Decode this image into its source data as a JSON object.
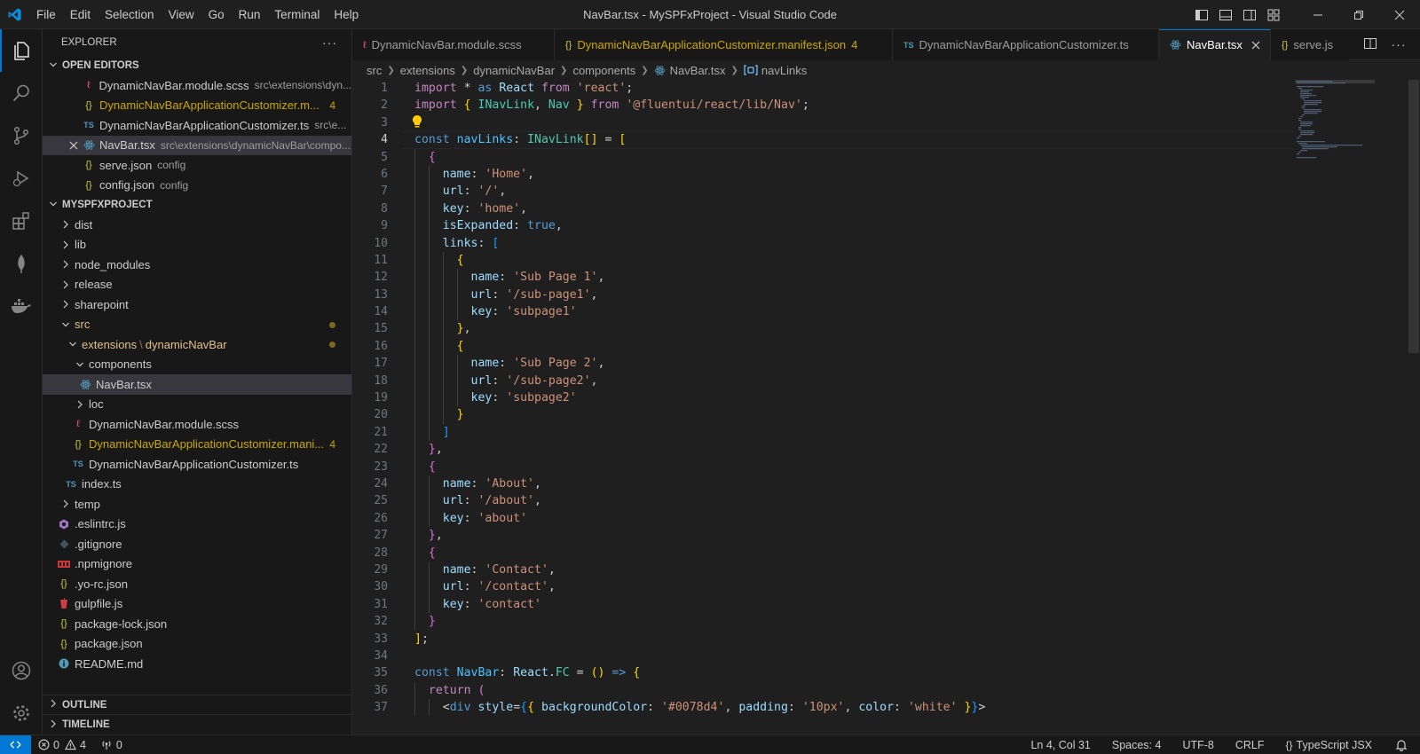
{
  "titlebar": {
    "menu": [
      "File",
      "Edit",
      "Selection",
      "View",
      "Go",
      "Run",
      "Terminal",
      "Help"
    ],
    "window_title": "NavBar.tsx - MySPFxProject - Visual Studio Code"
  },
  "colors": {
    "accent": "#0078d4",
    "warning": "#cca700",
    "modified_folder": "#e2c08d"
  },
  "explorer": {
    "header": "EXPLORER",
    "open_editors_label": "OPEN EDITORS",
    "open_editors": [
      {
        "icon": "scss-icon",
        "name": "DynamicNavBar.module.scss",
        "desc": "src\\extensions\\dyn..."
      },
      {
        "icon": "json-icon",
        "name": "DynamicNavBarApplicationCustomizer.m...",
        "badge": "4"
      },
      {
        "icon": "ts-icon",
        "name": "DynamicNavBarApplicationCustomizer.ts",
        "desc": "src\\e..."
      },
      {
        "icon": "react-icon",
        "name": "NavBar.tsx",
        "desc": "src\\extensions\\dynamicNavBar\\compo..."
      },
      {
        "icon": "json-icon",
        "name": "serve.json",
        "desc": "config"
      },
      {
        "icon": "json-icon",
        "name": "config.json",
        "desc": "config"
      }
    ],
    "project_label": "MYSPFXPROJECT",
    "tree": [
      {
        "name": "dist"
      },
      {
        "name": "lib"
      },
      {
        "name": "node_modules"
      },
      {
        "name": "release"
      },
      {
        "name": "sharepoint"
      },
      {
        "name": "src"
      },
      {
        "name": "extensions",
        "sep": "\\",
        "name2": "dynamicNavBar"
      },
      {
        "name": "components"
      },
      {
        "name": "NavBar.tsx"
      },
      {
        "name": "loc"
      },
      {
        "name": "DynamicNavBar.module.scss"
      },
      {
        "name": "DynamicNavBarApplicationCustomizer.mani...",
        "badge": "4"
      },
      {
        "name": "DynamicNavBarApplicationCustomizer.ts"
      },
      {
        "name": "index.ts"
      },
      {
        "name": "temp"
      },
      {
        "name": ".eslintrc.js"
      },
      {
        "name": ".gitignore"
      },
      {
        "name": ".npmignore"
      },
      {
        "name": ".yo-rc.json"
      },
      {
        "name": "gulpfile.js"
      },
      {
        "name": "package-lock.json"
      },
      {
        "name": "package.json"
      },
      {
        "name": "README.md"
      }
    ],
    "outline_label": "OUTLINE",
    "timeline_label": "TIMELINE"
  },
  "tabs": [
    {
      "name": "DynamicNavBar.module.scss"
    },
    {
      "name": "DynamicNavBarApplicationCustomizer.manifest.json",
      "badge": "4"
    },
    {
      "name": "DynamicNavBarApplicationCustomizer.ts",
      "prefix": "TS"
    },
    {
      "name": "NavBar.tsx",
      "active": true
    },
    {
      "name": "serve.js"
    }
  ],
  "breadcrumb": [
    "src",
    "extensions",
    "dynamicNavBar",
    "components",
    "NavBar.tsx",
    "navLinks"
  ],
  "editor": {
    "line_numbers": [
      "1",
      "2",
      "3",
      "4",
      "5",
      "6",
      "7",
      "8",
      "9",
      "10",
      "11",
      "12",
      "13",
      "14",
      "15",
      "16",
      "17",
      "18",
      "19",
      "20",
      "21",
      "22",
      "23",
      "24",
      "25",
      "26",
      "27",
      "28",
      "29",
      "30",
      "31",
      "32",
      "33",
      "34",
      "35",
      "36",
      "37"
    ],
    "current_line": 4,
    "lines": [
      "import * as React from 'react';",
      "import { INavLink, Nav } from '@fluentui/react/lib/Nav';",
      "",
      "const navLinks: INavLink[] = [",
      "  {",
      "    name: 'Home',",
      "    url: '/',",
      "    key: 'home',",
      "    isExpanded: true,",
      "    links: [",
      "      {",
      "        name: 'Sub Page 1',",
      "        url: '/sub-page1',",
      "        key: 'subpage1'",
      "      },",
      "      {",
      "        name: 'Sub Page 2',",
      "        url: '/sub-page2',",
      "        key: 'subpage2'",
      "      }",
      "    ]",
      "  },",
      "  {",
      "    name: 'About',",
      "    url: '/about',",
      "    key: 'about'",
      "  },",
      "  {",
      "    name: 'Contact',",
      "    url: '/contact',",
      "    key: 'contact'",
      "  }",
      "];",
      "",
      "const NavBar: React.FC = () => {",
      "  return (",
      "    <div style={{ backgroundColor: '#0078d4', padding: '10px', color: 'white' }}>"
    ]
  },
  "statusbar": {
    "errors": "0",
    "warnings": "4",
    "ports": "0",
    "position": "Ln 4, Col 31",
    "spaces": "Spaces: 4",
    "encoding": "UTF-8",
    "eol": "CRLF",
    "language": "TypeScript JSX"
  }
}
